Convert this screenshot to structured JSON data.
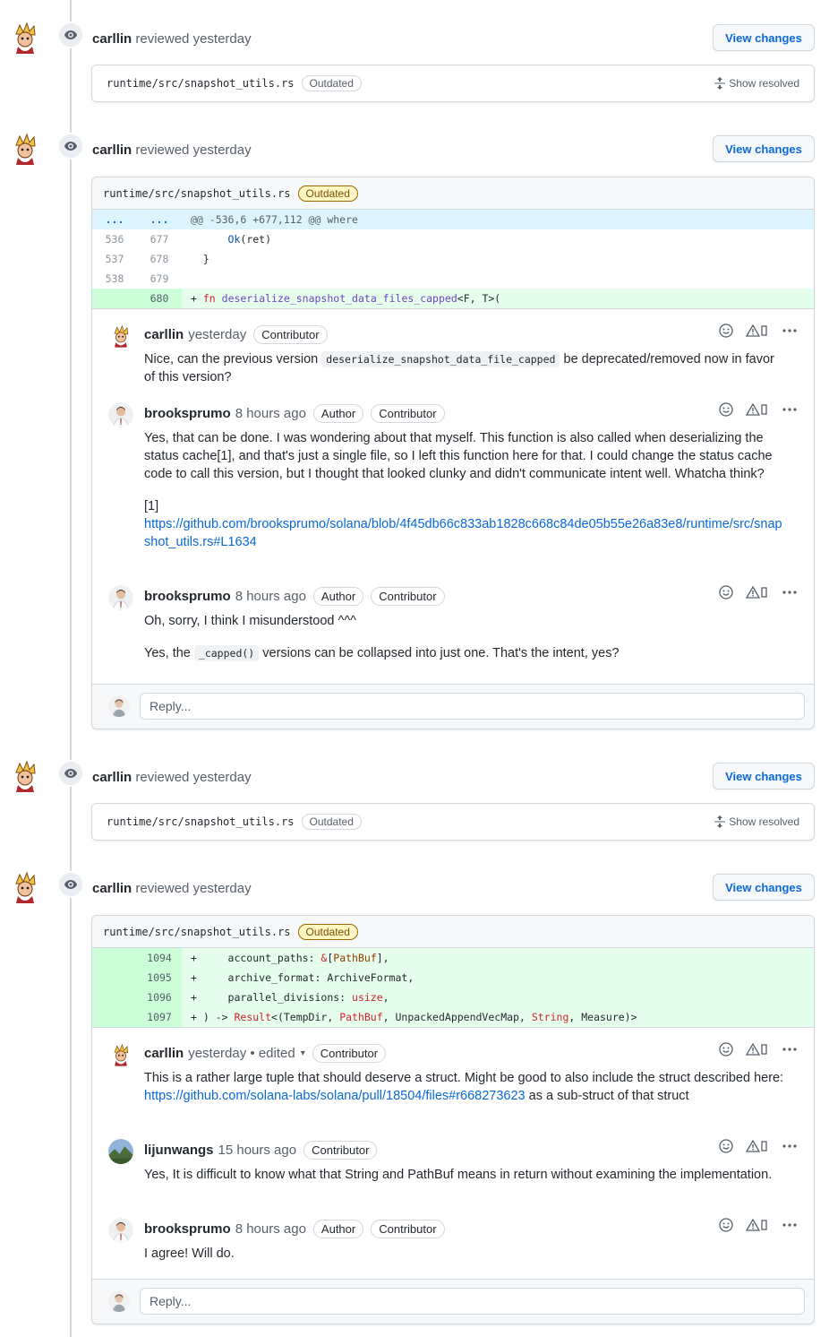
{
  "reviews": [
    {
      "author": "carllin",
      "action": "reviewed",
      "time": "yesterday",
      "view_btn": "View changes",
      "file": "runtime/src/snapshot_utils.rs",
      "badge": "Outdated",
      "show_resolved": "Show resolved"
    },
    {
      "author": "carllin",
      "action": "reviewed",
      "time": "yesterday",
      "view_btn": "View changes",
      "file": "runtime/src/snapshot_utils.rs",
      "badge": "Outdated",
      "hunk": {
        "old": "...",
        "new": "...",
        "text": "@@ -536,6 +677,112 @@ where"
      },
      "lines": [
        {
          "old": "536",
          "new": "677",
          "text": "      Ok(ret)"
        },
        {
          "old": "537",
          "new": "678",
          "text": "  }"
        },
        {
          "old": "538",
          "new": "679",
          "text": ""
        },
        {
          "old": "",
          "new": "680",
          "text": "+ fn deserialize_snapshot_data_files_capped<F, T>("
        }
      ],
      "comments": [
        {
          "author": "carllin",
          "time": "yesterday",
          "badges": [
            "Contributor"
          ],
          "body_pre": "Nice, can the previous version",
          "code": "deserialize_snapshot_data_file_capped",
          "body_post": "be deprecated/removed now in favor of this version?"
        },
        {
          "author": "brooksprumo",
          "time": "8 hours ago",
          "badges": [
            "Author",
            "Contributor"
          ],
          "p1": "Yes, that can be done. I was wondering about that myself. This function is also called when deserializing the status cache[1], and that's just a single file, so I left this function here for that. I could change the status cache code to call this version, but I thought that looked clunky and didn't communicate intent well. Whatcha think?",
          "ref": "[1]",
          "link": "https://github.com/brooksprumo/solana/blob/4f45db66c833ab1828c668c84de05b55e26a83e8/runtime/src/snapshot_utils.rs#L1634"
        },
        {
          "author": "brooksprumo",
          "time": "8 hours ago",
          "badges": [
            "Author",
            "Contributor"
          ],
          "p1": "Oh, sorry, I think I misunderstood ^^^",
          "p2_pre": "Yes, the",
          "code": "_capped()",
          "p2_post": "versions can be collapsed into just one. That's the intent, yes?"
        }
      ],
      "reply_placeholder": "Reply..."
    },
    {
      "author": "carllin",
      "action": "reviewed",
      "time": "yesterday",
      "view_btn": "View changes",
      "file": "runtime/src/snapshot_utils.rs",
      "badge": "Outdated",
      "show_resolved": "Show resolved"
    },
    {
      "author": "carllin",
      "action": "reviewed",
      "time": "yesterday",
      "view_btn": "View changes",
      "file": "runtime/src/snapshot_utils.rs",
      "badge": "Outdated",
      "lines": [
        {
          "new": "1094",
          "text": "+     account_paths: &[PathBuf],"
        },
        {
          "new": "1095",
          "text": "+     archive_format: ArchiveFormat,"
        },
        {
          "new": "1096",
          "text": "+     parallel_divisions: usize,"
        },
        {
          "new": "1097",
          "text": "+ ) -> Result<(TempDir, PathBuf, UnpackedAppendVecMap, String, Measure)>"
        }
      ],
      "comments": [
        {
          "author": "carllin",
          "time": "yesterday",
          "edited": "• edited",
          "badges": [
            "Contributor"
          ],
          "body_pre": "This is a rather large tuple that should deserve a struct. Might be good to also include the struct described here:",
          "link": "https://github.com/solana-labs/solana/pull/18504/files#r668273623",
          "body_post": "as a sub-struct of that struct"
        },
        {
          "author": "lijunwangs",
          "time": "15 hours ago",
          "badges": [
            "Contributor"
          ],
          "body": "Yes, It is difficult to know what that String and PathBuf means in return without examining the implementation."
        },
        {
          "author": "brooksprumo",
          "time": "8 hours ago",
          "badges": [
            "Author",
            "Contributor"
          ],
          "body": "I agree! Will do."
        }
      ],
      "reply_placeholder": "Reply..."
    }
  ],
  "colors": {
    "link": "#0969da",
    "outdated": "#9a6700",
    "add_bg": "#e6ffec",
    "hunk_bg": "#ddf4ff"
  }
}
